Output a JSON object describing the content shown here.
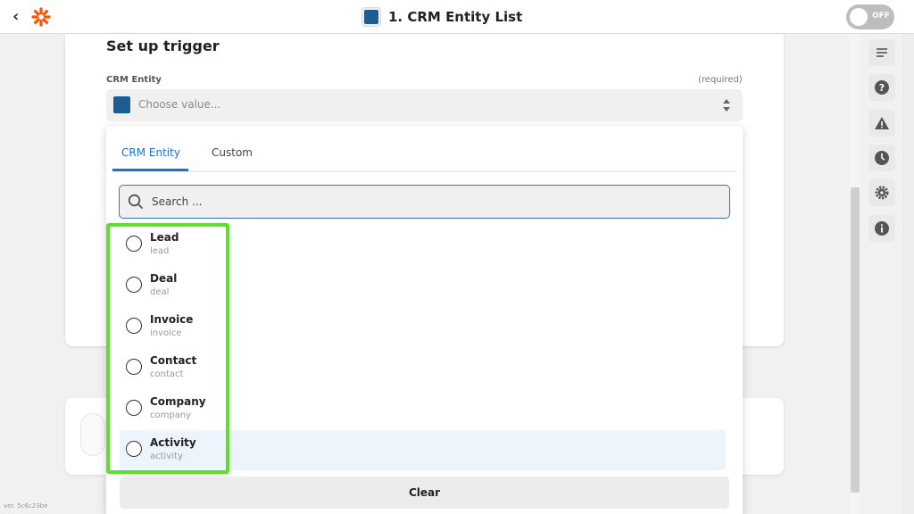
{
  "header": {
    "title": "1. CRM Entity List",
    "toggle_label": "OFF"
  },
  "trigger": {
    "section_title": "Set up trigger",
    "field_label": "CRM Entity",
    "required_label": "(required)",
    "select_placeholder": "Choose value..."
  },
  "dropdown": {
    "tabs": [
      {
        "label": "CRM Entity",
        "active": true
      },
      {
        "label": "Custom",
        "active": false
      }
    ],
    "search_placeholder": "Search ...",
    "options": [
      {
        "label": "Lead",
        "value": "lead"
      },
      {
        "label": "Deal",
        "value": "deal"
      },
      {
        "label": "Invoice",
        "value": "invoice"
      },
      {
        "label": "Contact",
        "value": "contact"
      },
      {
        "label": "Company",
        "value": "company"
      },
      {
        "label": "Activity",
        "value": "activity"
      }
    ],
    "clear_label": "Clear"
  },
  "sidebar": {
    "icons": [
      "list-icon",
      "help-icon",
      "warning-icon",
      "history-icon",
      "settings-icon",
      "info-icon"
    ]
  },
  "footer": {
    "version": "ver. 5c6c23be"
  },
  "colors": {
    "accent": "#1e6fd1",
    "highlight_box": "#5ce02a",
    "brand": "#ff4f00"
  }
}
